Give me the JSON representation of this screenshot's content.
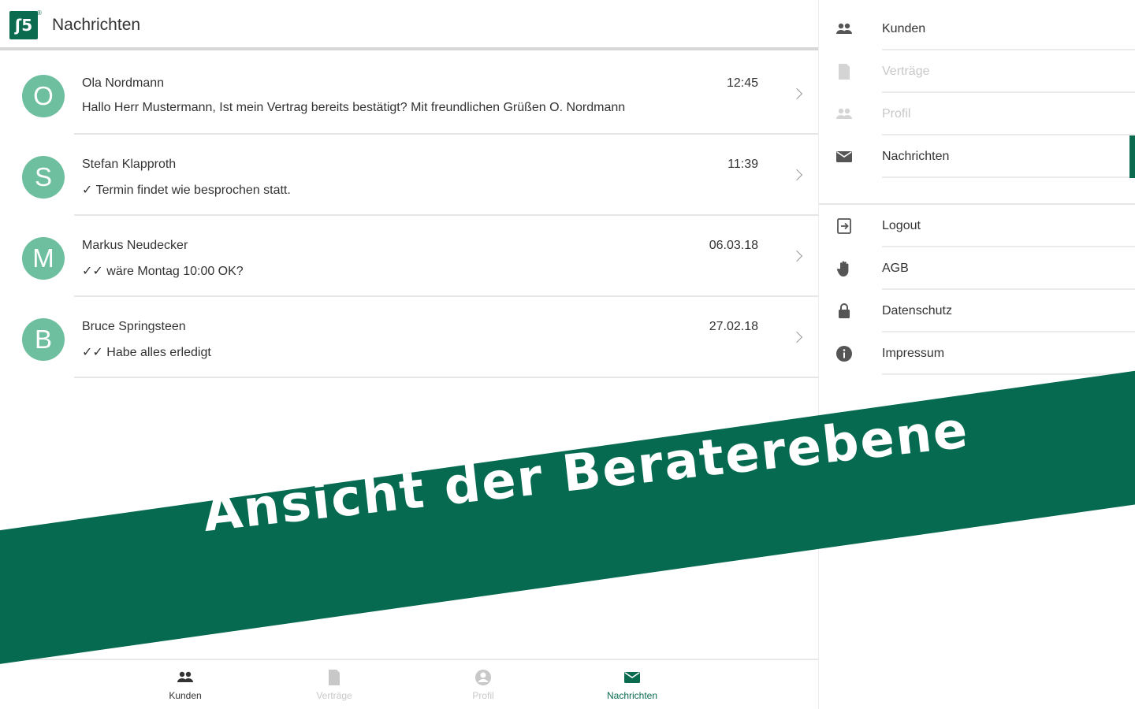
{
  "header": {
    "logo_glyph": "ʃ5",
    "logo_reg": "®",
    "title": "Nachrichten"
  },
  "messages": [
    {
      "initial": "O",
      "sender": "Ola Nordmann",
      "time": "12:45",
      "preview": "Hallo Herr Mustermann, Ist mein Vertrag bereits bestätigt? Mit freundlichen Grüßen O. Nordmann"
    },
    {
      "initial": "S",
      "sender": "Stefan Klapproth",
      "time": "11:39",
      "preview": "✓ Termin findet wie besprochen statt."
    },
    {
      "initial": "M",
      "sender": "Markus Neudecker",
      "time": "06.03.18",
      "preview": "✓✓ wäre Montag 10:00 OK?"
    },
    {
      "initial": "B",
      "sender": "Bruce Springsteen",
      "time": "27.02.18",
      "preview": "✓✓ Habe alles erledigt"
    }
  ],
  "bottom_nav": [
    {
      "label": "Kunden",
      "icon": "people-icon",
      "state": "normal"
    },
    {
      "label": "Verträge",
      "icon": "document-icon",
      "state": "disabled"
    },
    {
      "label": "Profil",
      "icon": "person-circle-icon",
      "state": "disabled"
    },
    {
      "label": "Nachrichten",
      "icon": "mail-icon",
      "state": "active"
    }
  ],
  "drawer": {
    "items": [
      {
        "label": "Kunden",
        "icon": "people-icon",
        "state": "normal"
      },
      {
        "label": "Verträge",
        "icon": "document-icon",
        "state": "disabled"
      },
      {
        "label": "Profil",
        "icon": "people-icon",
        "state": "disabled"
      },
      {
        "label": "Nachrichten",
        "icon": "mail-icon",
        "state": "active"
      },
      {
        "label": "Logout",
        "icon": "logout-icon",
        "state": "normal"
      },
      {
        "label": "AGB",
        "icon": "hand-icon",
        "state": "normal"
      },
      {
        "label": "Datenschutz",
        "icon": "lock-icon",
        "state": "normal"
      },
      {
        "label": "Impressum",
        "icon": "info-icon",
        "state": "normal"
      }
    ]
  },
  "banner": {
    "text": "Ansicht der Beraterebene"
  },
  "colors": {
    "brand": "#0b6b4f",
    "avatar": "#6dbf9f",
    "banner": "#066a50",
    "disabled": "#c8c8c8",
    "icon": "#555555"
  }
}
